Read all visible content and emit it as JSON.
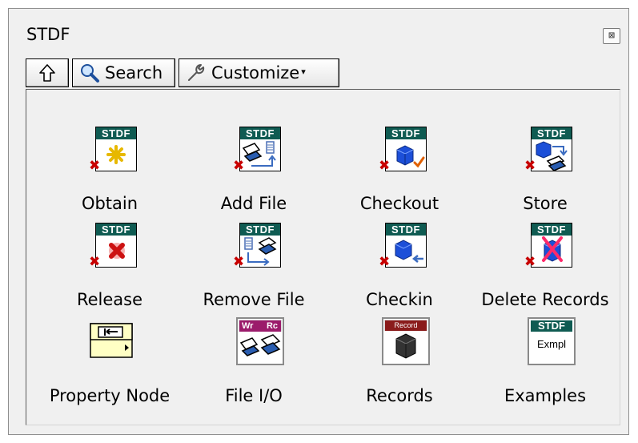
{
  "window": {
    "title": "STDF",
    "close_glyph": "⊠"
  },
  "toolbar": {
    "up_icon": "up-arrow-icon",
    "search_label": "Search",
    "customize_label": "Customize",
    "customize_caret": "▾"
  },
  "icon_text": {
    "stdf": "STDF",
    "wr": "Wr",
    "rc": "Rc",
    "record": "Record",
    "exmpl": "Exmpl"
  },
  "items": [
    {
      "label": "Obtain",
      "icon": "obtain-icon"
    },
    {
      "label": "Add File",
      "icon": "add-file-icon"
    },
    {
      "label": "Checkout",
      "icon": "checkout-icon"
    },
    {
      "label": "Store",
      "icon": "store-icon"
    },
    {
      "label": "Release",
      "icon": "release-icon"
    },
    {
      "label": "Remove File",
      "icon": "remove-file-icon"
    },
    {
      "label": "Checkin",
      "icon": "checkin-icon"
    },
    {
      "label": "Delete Records",
      "icon": "delete-records-icon"
    },
    {
      "label": "Property Node",
      "icon": "property-node-icon"
    },
    {
      "label": "File I/O",
      "icon": "file-io-icon"
    },
    {
      "label": "Records",
      "icon": "records-icon"
    },
    {
      "label": "Examples",
      "icon": "examples-icon"
    }
  ],
  "colors": {
    "stdf_header": "#0f5b52",
    "error_x": "#c80000",
    "file_io_header": "#9b1b6b",
    "records_header": "#8a1b1b"
  }
}
